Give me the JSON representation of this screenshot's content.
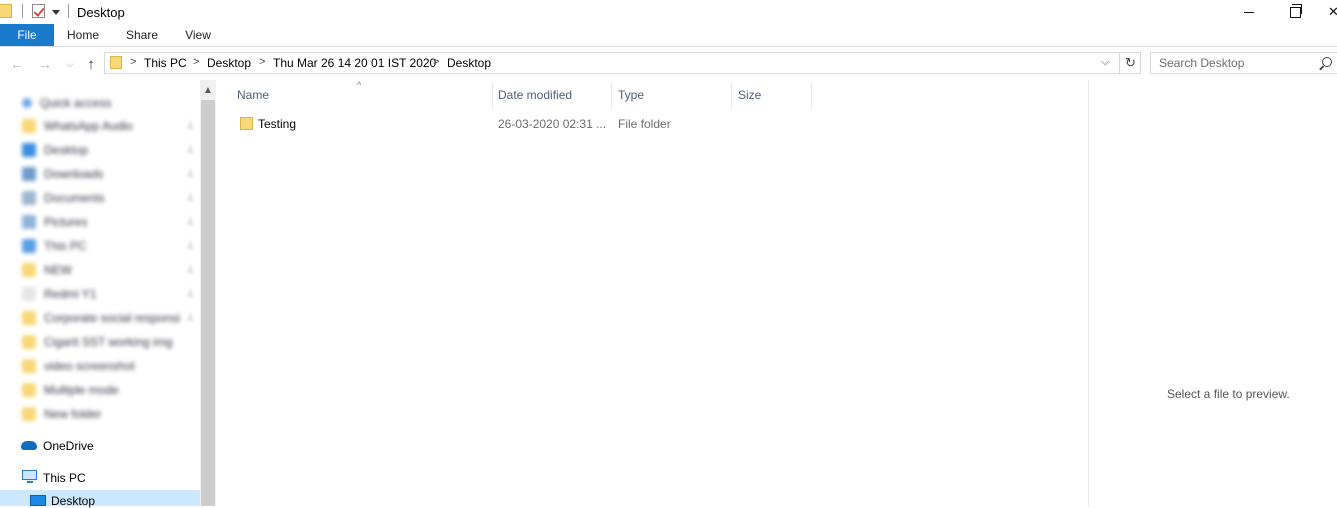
{
  "window": {
    "title": "Desktop"
  },
  "ribbon": {
    "tabs": [
      {
        "label": "File"
      },
      {
        "label": "Home"
      },
      {
        "label": "Share"
      },
      {
        "label": "View"
      }
    ],
    "accent": "#1979ca"
  },
  "address": {
    "crumbs": [
      "This PC",
      "Desktop",
      "Thu Mar 26 14 20 01 IST 2020",
      "Desktop"
    ]
  },
  "search": {
    "placeholder": "Search Desktop"
  },
  "navpane": {
    "quick_access": {
      "label": "Quick access"
    },
    "blurred_items": [
      {
        "label": "WhatsApp Audio",
        "icon": "folder-icon"
      },
      {
        "label": "Desktop",
        "icon": "desktop-icon"
      },
      {
        "label": "Downloads",
        "icon": "downloads-icon"
      },
      {
        "label": "Documents",
        "icon": "documents-icon"
      },
      {
        "label": "Pictures",
        "icon": "pictures-icon"
      },
      {
        "label": "This PC",
        "icon": "computer-icon"
      },
      {
        "label": "NEW",
        "icon": "folder-icon"
      },
      {
        "label": "Redmi Y1",
        "icon": "phone-icon"
      },
      {
        "label": "Corporate social responsi",
        "icon": "folder-icon"
      },
      {
        "label": "Cigarit SST working img",
        "icon": "folder-icon"
      },
      {
        "label": "video screenshot",
        "icon": "folder-icon"
      },
      {
        "label": "Multiple mode",
        "icon": "folder-icon"
      },
      {
        "label": "New folder",
        "icon": "folder-icon"
      }
    ],
    "onedrive": {
      "label": "OneDrive"
    },
    "this_pc": {
      "label": "This PC"
    },
    "desktop": {
      "label": "Desktop"
    }
  },
  "columns": {
    "name": "Name",
    "date_modified": "Date modified",
    "type": "Type",
    "size": "Size"
  },
  "files": [
    {
      "name": "Testing",
      "date_modified": "26-03-2020 02:31 ...",
      "type": "File folder",
      "size": ""
    }
  ],
  "preview": {
    "message": "Select a file to preview."
  }
}
